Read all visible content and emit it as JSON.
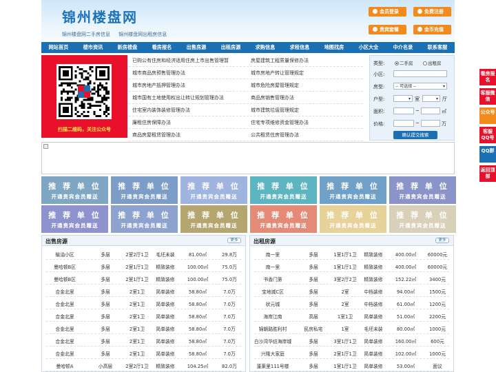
{
  "header": {
    "title": "锦州楼盘网",
    "links": [
      "锦州楼盘网二手房信息",
      "锦州楼盘网出租房信息"
    ],
    "buttons": [
      "会员登录",
      "免费注册",
      "贵宾套餐",
      "金币充值"
    ]
  },
  "nav": [
    "网站首页",
    "楼市资讯",
    "新房楼盘",
    "看房报名",
    "出售房源",
    "出租房源",
    "求购信息",
    "求租信息",
    "地图找房",
    "小区大全",
    "中介名录",
    "联系客服"
  ],
  "qr": {
    "caption": "扫描二维码，关注公众号"
  },
  "laws": {
    "left": [
      "已购公有住房和经济适用住房上市出售管理暂",
      "城市商品房预售管理办法",
      "城市房地产抵押管理办法",
      "城市国有土地使用权出让转让规划管理办法",
      "住宅室内装饰装修管理办法",
      "廉租住房保障办法",
      "商品房屋租赁管理办法"
    ],
    "right": [
      "房屋建筑工程质量保修办法",
      "城市房地产转让管理规定",
      "城市危险房屋管理规定",
      "商品房销售管理办法",
      "城市建筑垃圾管理规定",
      "住宅专项维修资金管理办法",
      "公共租赁住房管理办法"
    ]
  },
  "search": {
    "type_label": "类型:",
    "type_options": [
      "二手房",
      "出租房"
    ],
    "type_selected": "二手房",
    "community_label": "小区:",
    "community_value": "",
    "housetype_label": "房型:",
    "housetype_value": "-- 可选择 --",
    "layout_label": "户型:",
    "room_unit": "室",
    "hall_unit": "厅",
    "area_label": "面积:",
    "area_unit": "㎡",
    "price_label": "价格:",
    "price_unit": "万",
    "range_sep": "~",
    "submit": "确认提交搜索"
  },
  "ads": {
    "title": "推 荐 单 位",
    "subtitle": "开通贵宾会员赠送",
    "colors": [
      "#7fa7c4",
      "#7b9dc8",
      "#9fb5e0",
      "#5db5c2",
      "#6fa0c8",
      "#8b94c8",
      "#8e93cf",
      "#8ea2d0",
      "#b5a670",
      "#e38b76",
      "#e7d29a",
      "#d8d0b8"
    ]
  },
  "sale": {
    "title": "出售房源",
    "more": "更多",
    "rows": [
      [
        "输油小区",
        "多层",
        "2室2厅1卫",
        "毛坯未装",
        "81.00㎡",
        "29.8万"
      ],
      [
        "曼哈顿B区",
        "多层",
        "2室1厅1卫",
        "精致装修",
        "100.00㎡",
        "75.0万"
      ],
      [
        "曼哈顿B区",
        "多层",
        "2室1厅1卫",
        "精致装修",
        "100.00㎡",
        "75.0万"
      ],
      [
        "合金北里",
        "多层",
        "2室1卫",
        "简单装修",
        "58.80㎡",
        "7.0万"
      ],
      [
        "合金北里",
        "多层",
        "2室1卫",
        "简单装修",
        "58.80㎡",
        "7.0万"
      ],
      [
        "合金北里",
        "多层",
        "2室1卫",
        "简单装修",
        "58.80㎡",
        "7.0万"
      ],
      [
        "合金北里",
        "多层",
        "2室1卫",
        "简单装修",
        "58.80㎡",
        "7.0万"
      ],
      [
        "合金北里",
        "多层",
        "2室1卫",
        "简单装修",
        "58.80㎡",
        "7.0万"
      ],
      [
        "合金北里",
        "多层",
        "2室1卫",
        "简单装修",
        "58.80㎡",
        "7.0万"
      ],
      [
        "曼哈顿A",
        "小高层",
        "2室2厅1卫",
        "精致装修",
        "104.25㎡",
        "82.0万"
      ]
    ]
  },
  "rent": {
    "title": "出租房源",
    "more": "更多",
    "rows": [
      [
        "南一里",
        "多层",
        "1室1厅1卫",
        "精致装修",
        "400.00㎡",
        "60000元"
      ],
      [
        "南一里",
        "多层",
        "1室1厅1卫",
        "精致装修",
        "400.00㎡",
        "60000元"
      ],
      [
        "书香门第",
        "多层",
        "3室2厅2卫",
        "精致装修",
        "152.22㎡",
        "3400元"
      ],
      [
        "宝地城C区",
        "多层",
        "2室",
        "中档装修",
        "94.00㎡",
        "1500元"
      ],
      [
        "状元城",
        "多层",
        "2室",
        "中档装修",
        "61.00㎡",
        "1200元"
      ],
      [
        "海岸江南",
        "高层",
        "1室1卫",
        "简单装修",
        "51.00㎡",
        "2200元"
      ],
      [
        "锦朝路胜利村",
        "民房私宅",
        "1室",
        "毛坯未装",
        "80.00㎡",
        "1000元"
      ],
      [
        "白沙湾华纺海岸城",
        "多层",
        "3室1厅1卫",
        "简单装修",
        "160.00㎡",
        "600元"
      ],
      [
        "兴隆大家庭",
        "多层",
        "2室1厅1卫",
        "简单装修",
        "102.00㎡",
        "1000元"
      ],
      [
        "蓬莱里111号楼",
        "多层",
        "1室1厅1卫",
        "简单装修",
        "53.00㎡",
        "面议"
      ]
    ]
  },
  "side": [
    "看房报名",
    "客服微信",
    "公众号",
    "客服QQ号",
    "QQ群",
    "返回顶部"
  ],
  "colors": {
    "nav": "#1b6fb3",
    "orange": "#f28a1c",
    "red": "#e8102a"
  }
}
